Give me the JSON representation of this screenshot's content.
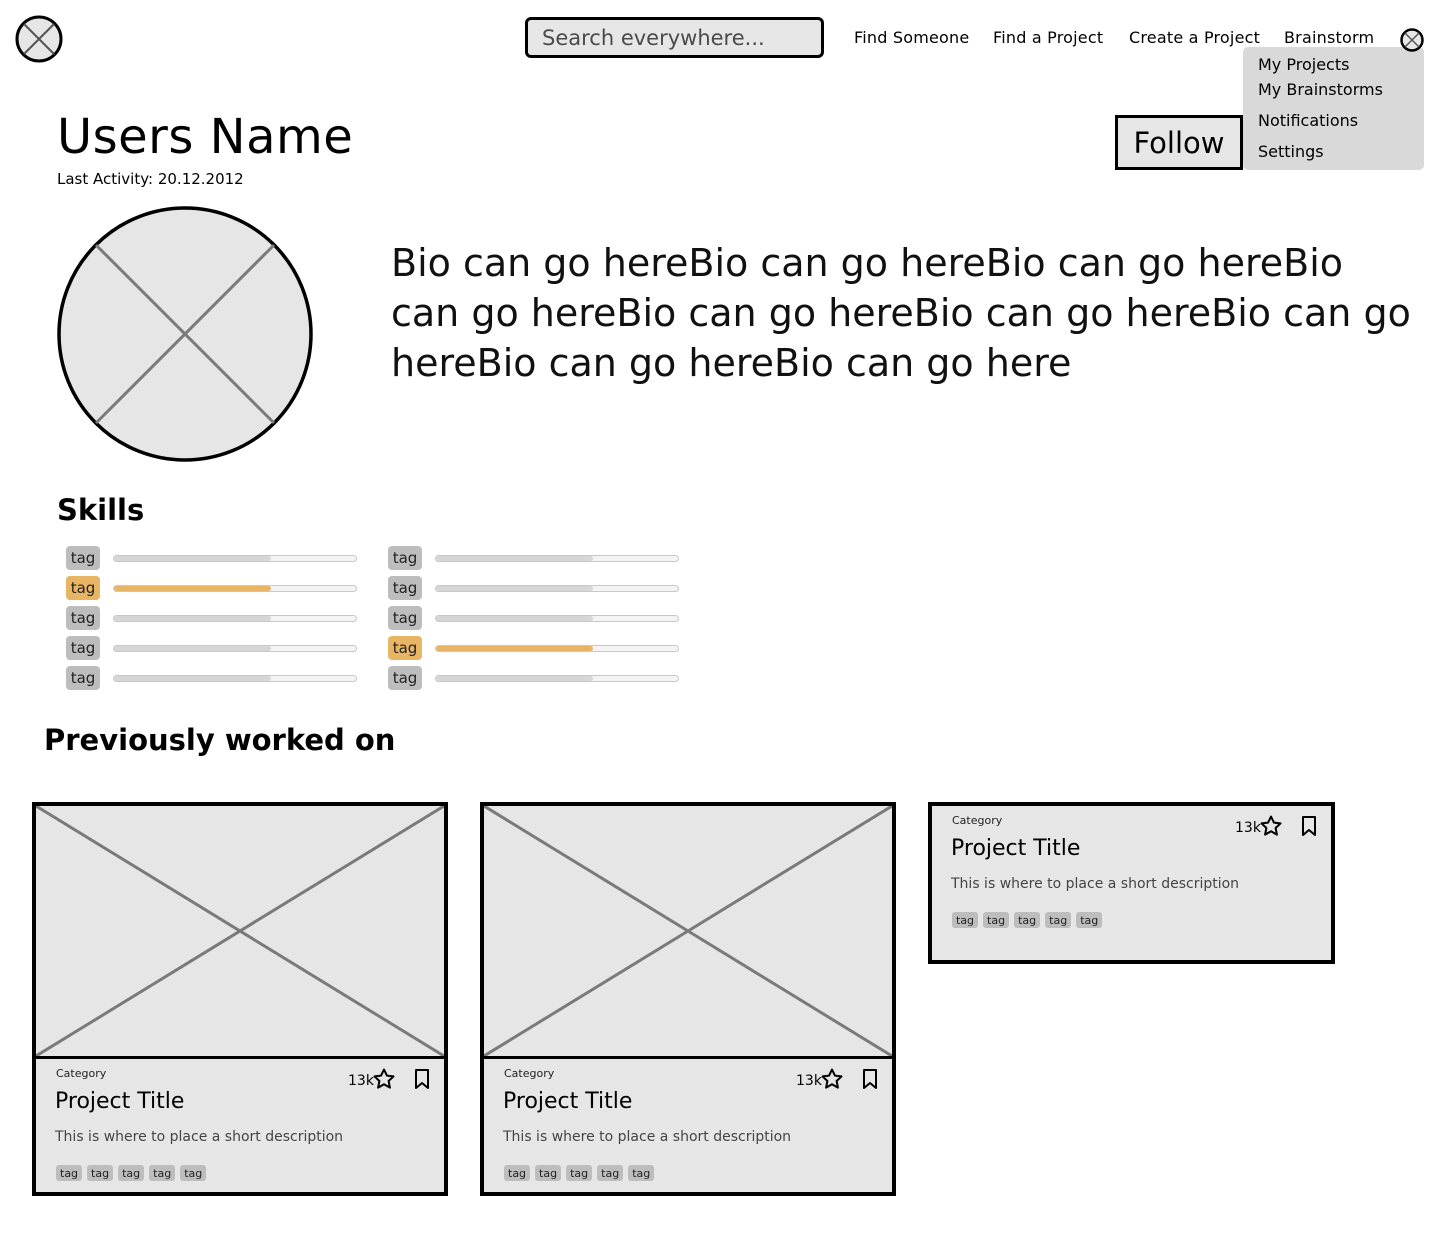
{
  "header": {
    "search_placeholder": "Search everywhere...",
    "nav": [
      "Find Someone",
      "Find a Project",
      "Create a Project",
      "Brainstorm"
    ]
  },
  "user_menu": {
    "items": [
      "My Projects",
      "My Brainstorms",
      "Notifications",
      "Settings"
    ]
  },
  "profile": {
    "name": "Users Name",
    "last_activity": "Last Activity: 20.12.2012",
    "follow_label": "Follow",
    "bio": "Bio can go hereBio can go hereBio can go hereBio can go hereBio can go hereBio can go hereBio can go hereBio can go hereBio can go here"
  },
  "skills": {
    "heading": "Skills",
    "items": [
      {
        "tag": "tag",
        "level": 0.65,
        "highlighted": false
      },
      {
        "tag": "tag",
        "level": 0.65,
        "highlighted": true
      },
      {
        "tag": "tag",
        "level": 0.65,
        "highlighted": false
      },
      {
        "tag": "tag",
        "level": 0.65,
        "highlighted": false
      },
      {
        "tag": "tag",
        "level": 0.65,
        "highlighted": false
      },
      {
        "tag": "tag",
        "level": 0.65,
        "highlighted": false
      },
      {
        "tag": "tag",
        "level": 0.65,
        "highlighted": false
      },
      {
        "tag": "tag",
        "level": 0.65,
        "highlighted": false
      },
      {
        "tag": "tag",
        "level": 0.65,
        "highlighted": true
      },
      {
        "tag": "tag",
        "level": 0.65,
        "highlighted": false
      }
    ]
  },
  "previous": {
    "heading": "Previously worked on",
    "projects": [
      {
        "category": "Category",
        "title": "Project Title",
        "description": "This is where to place a short description",
        "stars": "13k",
        "tags": [
          "tag",
          "tag",
          "tag",
          "tag",
          "tag"
        ],
        "has_image": true
      },
      {
        "category": "Category",
        "title": "Project Title",
        "description": "This is where to place a short description",
        "stars": "13k",
        "tags": [
          "tag",
          "tag",
          "tag",
          "tag",
          "tag"
        ],
        "has_image": true
      },
      {
        "category": "Category",
        "title": "Project Title",
        "description": "This is where to place a short description",
        "stars": "13k",
        "tags": [
          "tag",
          "tag",
          "tag",
          "tag",
          "tag"
        ],
        "has_image": false
      }
    ]
  },
  "colors": {
    "highlight": "#e8b564",
    "placeholder_fill": "#e6e6e6",
    "tag_gray": "#bdbdbd",
    "menu_bg": "#d9d9d9"
  }
}
